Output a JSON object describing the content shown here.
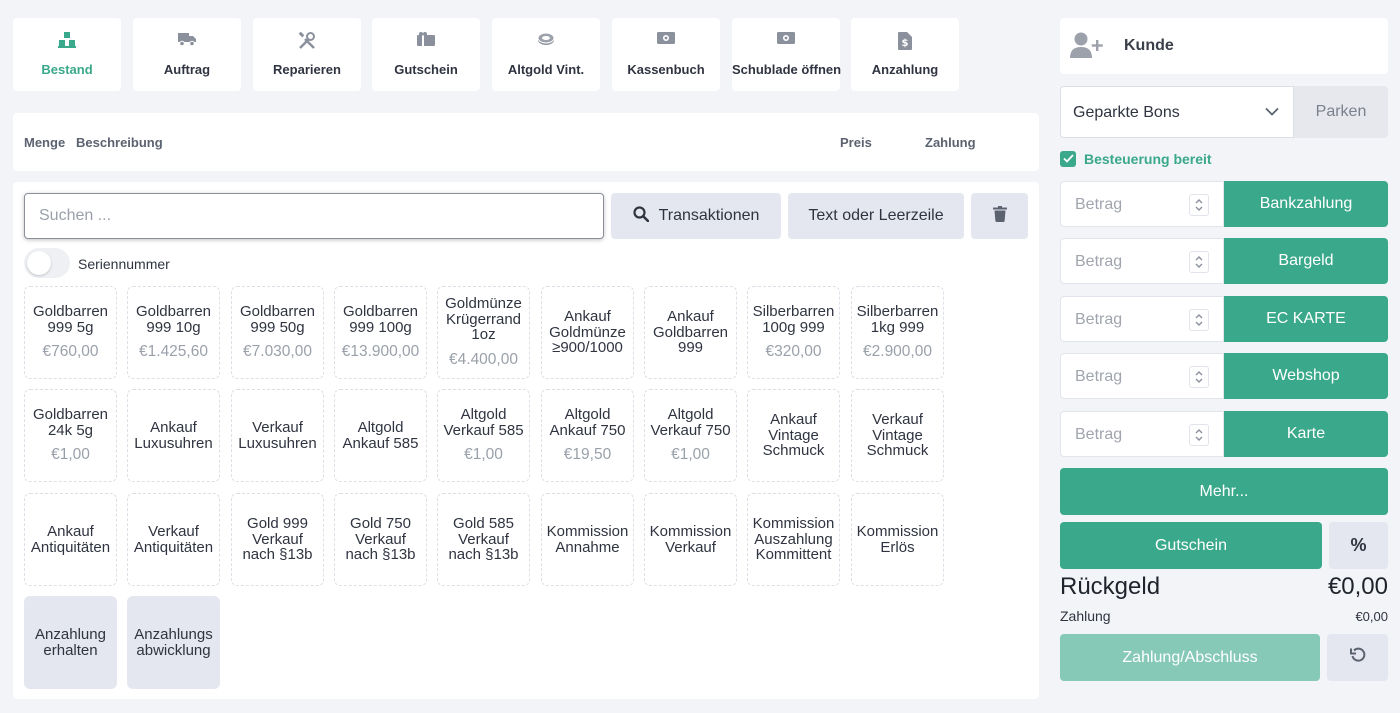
{
  "tabs": [
    {
      "label": "Bestand",
      "icon": "boxes-icon",
      "active": true
    },
    {
      "label": "Auftrag",
      "icon": "truck-icon"
    },
    {
      "label": "Reparieren",
      "icon": "tools-icon"
    },
    {
      "label": "Gutschein",
      "icon": "gift-icon"
    },
    {
      "label": "Altgold Vint.",
      "icon": "ring-icon"
    },
    {
      "label": "Kassenbuch",
      "icon": "money-icon"
    },
    {
      "label": "Schublade öffnen",
      "icon": "money-icon"
    },
    {
      "label": "Anzahlung",
      "icon": "invoice-dollar-icon"
    }
  ],
  "columns": {
    "menge": "Menge",
    "beschreibung": "Beschreibung",
    "preis": "Preis",
    "zahlung": "Zahlung"
  },
  "search": {
    "placeholder": "Suchen ..."
  },
  "buttons": {
    "transaktionen": "Transaktionen",
    "text_leerzeile": "Text oder Leerzeile"
  },
  "toggle": {
    "label": "Seriennummer"
  },
  "products": [
    {
      "name": "Goldbarren 999 5g",
      "price": "€760,00"
    },
    {
      "name": "Goldbarren 999 10g",
      "price": "€1.425,60"
    },
    {
      "name": "Goldbarren 999 50g",
      "price": "€7.030,00"
    },
    {
      "name": "Goldbarren 999 100g",
      "price": "€13.900,00"
    },
    {
      "name": "Goldmünze Krügerrand 1oz",
      "price": "€4.400,00"
    },
    {
      "name": "Ankauf Goldmünze ≥900/1000",
      "price": ""
    },
    {
      "name": "Ankauf Goldbarren 999",
      "price": ""
    },
    {
      "name": "Silberbarren 100g 999",
      "price": "€320,00"
    },
    {
      "name": "Silberbarren 1kg 999",
      "price": "€2.900,00"
    },
    {
      "name": "Goldbarren 24k 5g",
      "price": "€1,00"
    },
    {
      "name": "Ankauf Luxusuhren",
      "price": ""
    },
    {
      "name": "Verkauf Luxusuhren",
      "price": ""
    },
    {
      "name": "Altgold Ankauf 585",
      "price": ""
    },
    {
      "name": "Altgold Verkauf 585",
      "price": "€1,00"
    },
    {
      "name": "Altgold Ankauf 750",
      "price": "€19,50"
    },
    {
      "name": "Altgold Verkauf 750",
      "price": "€1,00"
    },
    {
      "name": "Ankauf Vintage Schmuck",
      "price": ""
    },
    {
      "name": "Verkauf Vintage Schmuck",
      "price": ""
    },
    {
      "name": "Ankauf Antiquitäten",
      "price": ""
    },
    {
      "name": "Verkauf Antiquitäten",
      "price": ""
    },
    {
      "name": "Gold 999 Verkauf nach §13b",
      "price": ""
    },
    {
      "name": "Gold 750 Verkauf nach §13b",
      "price": ""
    },
    {
      "name": "Gold 585 Verkauf nach §13b",
      "price": ""
    },
    {
      "name": "Kommission Annahme",
      "price": ""
    },
    {
      "name": "Kommission Verkauf",
      "price": ""
    },
    {
      "name": "Kommission Auszahlung Kommittent",
      "price": ""
    },
    {
      "name": "Kommission Erlös",
      "price": ""
    },
    {
      "name": "Anzahlung erhalten",
      "price": ""
    },
    {
      "name": "Anzahlungs abwicklung",
      "price": ""
    }
  ],
  "customer": {
    "label": "Kunde"
  },
  "parked": {
    "select_label": "Geparkte Bons",
    "park_button": "Parken"
  },
  "tax": {
    "label": "Besteuerung bereit",
    "checked": true
  },
  "payments": [
    {
      "placeholder": "Betrag",
      "method": "Bankzahlung"
    },
    {
      "placeholder": "Betrag",
      "method": "Bargeld"
    },
    {
      "placeholder": "Betrag",
      "method": "EC KARTE"
    },
    {
      "placeholder": "Betrag",
      "method": "Webshop"
    },
    {
      "placeholder": "Betrag",
      "method": "Karte"
    }
  ],
  "more_button": "Mehr...",
  "voucher_button": "Gutschein",
  "percent_button": "%",
  "change": {
    "label": "Rückgeld",
    "value": "€0,00"
  },
  "payment_total": {
    "label": "Zahlung",
    "value": "€0,00"
  },
  "checkout_button": "Zahlung/Abschluss",
  "colors": {
    "accent": "#3aa88a",
    "accent_disabled": "#86c9b6",
    "grey_button": "#e4e7ef"
  }
}
